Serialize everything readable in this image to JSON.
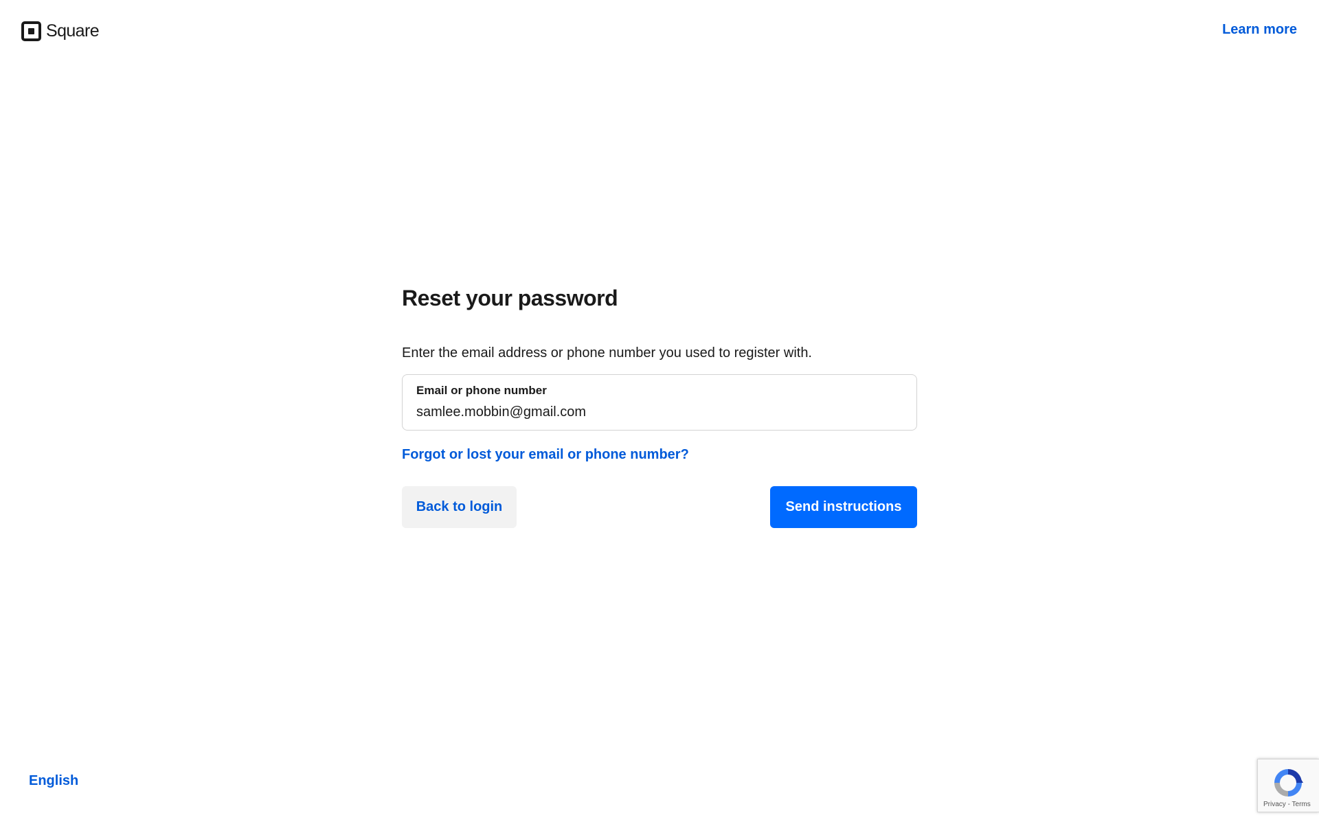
{
  "header": {
    "logo_text": "Square",
    "learn_more": "Learn more"
  },
  "form": {
    "title": "Reset your password",
    "instructions": "Enter the email address or phone number you used to register with.",
    "field_label": "Email or phone number",
    "field_value": "samlee.mobbin@gmail.com",
    "forgot_link": "Forgot or lost your email or phone number?",
    "back_button": "Back to login",
    "send_button": "Send instructions"
  },
  "footer": {
    "language": "English"
  },
  "recaptcha": {
    "privacy": "Privacy",
    "separator": "-",
    "terms": "Terms"
  },
  "colors": {
    "link": "#005ad9",
    "primary_button": "#006aff",
    "secondary_button": "#f2f2f2",
    "text": "#1a1a1a"
  }
}
